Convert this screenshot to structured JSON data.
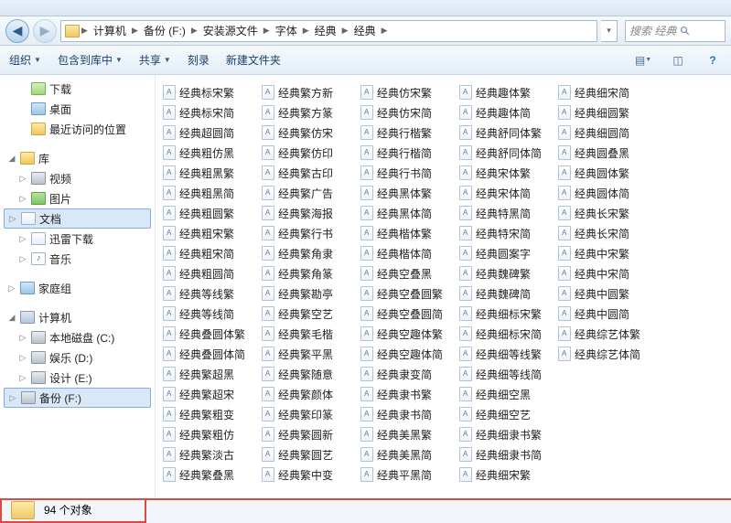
{
  "breadcrumb": [
    "计算机",
    "备份 (F:)",
    "安装源文件",
    "字体",
    "经典",
    "经典"
  ],
  "search_placeholder": "搜索 经典",
  "toolbar": {
    "organize": "组织",
    "include": "包含到库中",
    "share": "共享",
    "burn": "刻录",
    "newfolder": "新建文件夹"
  },
  "sidebar": {
    "downloads": "下载",
    "desktop": "桌面",
    "recent": "最近访问的位置",
    "lib": "库",
    "video": "视频",
    "pictures": "图片",
    "documents": "文档",
    "thunder": "迅雷下载",
    "music": "音乐",
    "homegroup": "家庭组",
    "computer": "计算机",
    "local_c": "本地磁盘 (C:)",
    "ent_d": "娱乐 (D:)",
    "design_e": "设计 (E:)",
    "backup_f": "备份 (F:)"
  },
  "files": [
    "经典标宋繁",
    "经典标宋简",
    "经典超圆简",
    "经典粗仿黑",
    "经典粗黑繁",
    "经典粗黑简",
    "经典粗圆繁",
    "经典粗宋繁",
    "经典粗宋简",
    "经典粗圆简",
    "经典等线繁",
    "经典等线简",
    "经典叠圆体繁",
    "经典叠圆体简",
    "经典繁超黑",
    "经典繁超宋",
    "经典繁粗变",
    "经典繁粗仿",
    "经典繁淡古",
    "经典繁叠黑",
    "经典繁方新",
    "经典繁方篆",
    "经典繁仿宋",
    "经典繁仿印",
    "经典繁古印",
    "经典繁广告",
    "经典繁海报",
    "经典繁行书",
    "经典繁角隶",
    "经典繁角篆",
    "经典繁勘亭",
    "经典繁空艺",
    "经典繁毛楷",
    "经典繁平黑",
    "经典繁随意",
    "经典繁颜体",
    "经典繁印篆",
    "经典繁圆新",
    "经典繁圆艺",
    "经典繁中变",
    "经典仿宋繁",
    "经典仿宋简",
    "经典行楷繁",
    "经典行楷简",
    "经典行书简",
    "经典黑体繁",
    "经典黑体简",
    "经典楷体繁",
    "经典楷体简",
    "经典空叠黑",
    "经典空叠圆繁",
    "经典空叠圆简",
    "经典空趣体繁",
    "经典空趣体简",
    "经典隶变简",
    "经典隶书繁",
    "经典隶书简",
    "经典美黑繁",
    "经典美黑简",
    "经典平黑简",
    "经典趣体繁",
    "经典趣体简",
    "经典舒同体繁",
    "经典舒同体简",
    "经典宋体繁",
    "经典宋体简",
    "经典特黑简",
    "经典特宋简",
    "经典圆案字",
    "经典魏碑繁",
    "经典魏碑简",
    "经典细标宋繁",
    "经典细标宋简",
    "经典细等线繁",
    "经典细等线简",
    "经典细空黑",
    "经典细空艺",
    "经典细隶书繁",
    "经典细隶书简",
    "经典细宋繁",
    "经典细宋简",
    "经典细圆繁",
    "经典细圆简",
    "经典圆叠黑",
    "经典圆体繁",
    "经典圆体简",
    "经典长宋繁",
    "经典长宋简",
    "经典中宋繁",
    "经典中宋简",
    "经典中圆繁",
    "经典中圆简",
    "经典综艺体繁",
    "经典综艺体简"
  ],
  "status": "94 个对象"
}
